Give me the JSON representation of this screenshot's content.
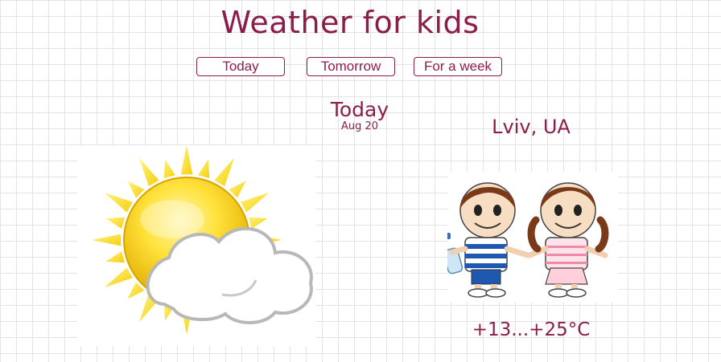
{
  "app": {
    "title": "Weather for kids"
  },
  "tabs": [
    {
      "label": "Today"
    },
    {
      "label": "Tomorrow"
    },
    {
      "label": "For a week"
    }
  ],
  "forecast": {
    "day": "Today",
    "date": "Aug 20",
    "city": "Lviv, UA",
    "temperature": "+13...+25°C",
    "condition_icon": "sun-behind-cloud-icon",
    "clothing_icon": "kids-summer-clothes-icon"
  },
  "colors": {
    "accent": "#8c1d4a",
    "sun": "#f7d21c",
    "cloud_outline": "#b5b5b5"
  }
}
